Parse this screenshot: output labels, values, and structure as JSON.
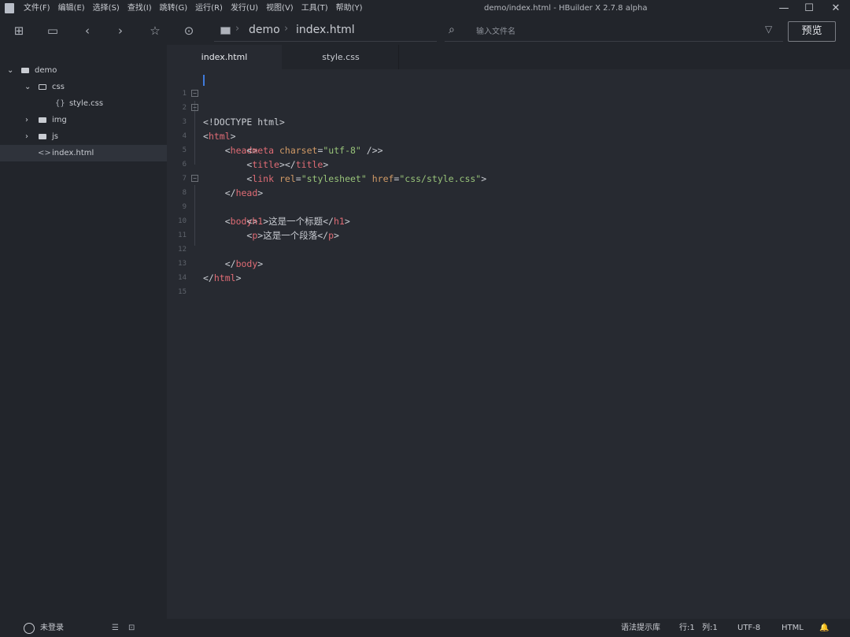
{
  "titlebar": {
    "menus": [
      "文件(F)",
      "编辑(E)",
      "选择(S)",
      "查找(I)",
      "跳转(G)",
      "运行(R)",
      "发行(U)",
      "视图(V)",
      "工具(T)",
      "帮助(Y)"
    ],
    "title": "demo/index.html - HBuilder X 2.7.8 alpha"
  },
  "toolbar": {
    "breadcrumb": [
      "demo",
      "index.html"
    ],
    "search_placeholder": "输入文件名",
    "preview_label": "预览"
  },
  "sidebar": {
    "items": [
      {
        "label": "demo",
        "type": "project"
      },
      {
        "label": "css",
        "type": "folder-open"
      },
      {
        "label": "style.css",
        "type": "css-file"
      },
      {
        "label": "img",
        "type": "folder"
      },
      {
        "label": "js",
        "type": "folder"
      },
      {
        "label": "index.html",
        "type": "html-file"
      }
    ]
  },
  "tabs": [
    {
      "label": "index.html",
      "active": true
    },
    {
      "label": "style.css",
      "active": false
    }
  ],
  "editor": {
    "line_numbers": [
      "1",
      "2",
      "3",
      "4",
      "5",
      "6",
      "7",
      "8",
      "9",
      "10",
      "11",
      "12",
      "13",
      "14",
      "15"
    ],
    "lines": {
      "l1": "<!DOCTYPE html>",
      "l2_open": "<",
      "l2_tag": "html",
      "l2_close": ">",
      "l3_tag": "head",
      "l4_tag": "meta",
      "l4_attr": "charset",
      "l4_val": "\"utf-8\"",
      "l4_end": " />",
      "l5_tag1": "title",
      "l5_tag2": "title",
      "l6_tag": "link",
      "l6_attr1": "rel",
      "l6_val1": "\"stylesheet\"",
      "l6_attr2": "href",
      "l6_val2": "\"css/style.css\"",
      "l7_tag": "head",
      "l8_tag": "body",
      "l9_tag1": "h1",
      "l9_text": "这是一个标题",
      "l9_tag2": "h1",
      "l10_tag1": "p",
      "l10_text": "这是一个段落",
      "l10_tag2": "p",
      "l12_tag": "body",
      "l13_tag": "html"
    }
  },
  "statusbar": {
    "user": "未登录",
    "syntax_lib": "语法提示库",
    "row": "行:1",
    "col": "列:1",
    "encoding": "UTF-8",
    "language": "HTML"
  },
  "colors": {
    "background": "#272a31",
    "panel": "#22252b",
    "tag": "#e06c75",
    "attribute": "#d19a66",
    "string": "#98c379",
    "cursor": "#3f7bdc"
  }
}
